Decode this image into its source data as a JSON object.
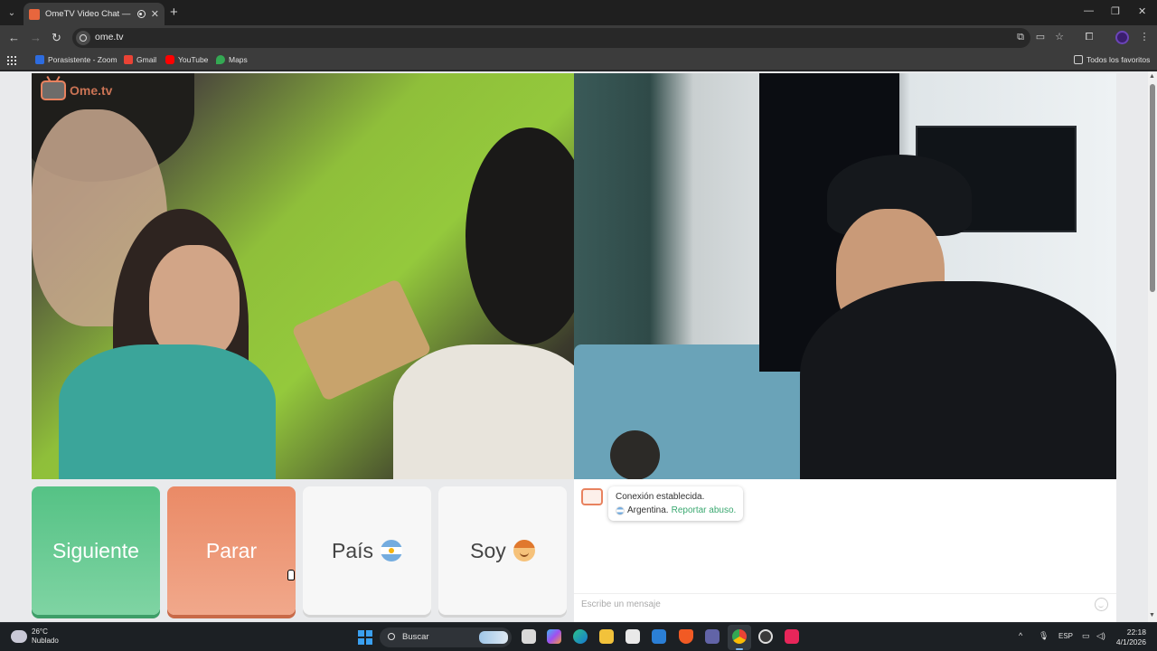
{
  "browser": {
    "tab_title": "OmeTV Video Chat — Ome",
    "url": "ome.tv",
    "bookmarks": [
      {
        "label": "Porasistente - Zoom",
        "color": "#2d6cdf"
      },
      {
        "label": "Gmail",
        "color": "#ea4335"
      },
      {
        "label": "YouTube",
        "color": "#ff0000"
      },
      {
        "label": "Maps",
        "color": "#34a853"
      }
    ],
    "all_bookmarks_label": "Todos los favoritos"
  },
  "page": {
    "logo_text": "Ome.tv",
    "buttons": {
      "next": "Siguiente",
      "stop": "Parar",
      "country": "País",
      "gender": "Soy"
    },
    "chat": {
      "status": "Conexión establecida.",
      "country": "Argentina.",
      "report_link": "Reportar abuso.",
      "input_placeholder": "Escribe un mensaje"
    },
    "colors": {
      "next": "#55c285",
      "stop": "#ea8a66",
      "brand": "#e8825f"
    }
  },
  "taskbar": {
    "temperature": "26°C",
    "weather": "Nublado",
    "search_label": "Buscar",
    "language": "ESP",
    "time": "22:18",
    "date": "4/1/2026",
    "apps": [
      "file-explorer",
      "copilot",
      "edge",
      "folder",
      "store",
      "mail",
      "brave",
      "teams",
      "chrome",
      "obs",
      "tiktok"
    ]
  }
}
